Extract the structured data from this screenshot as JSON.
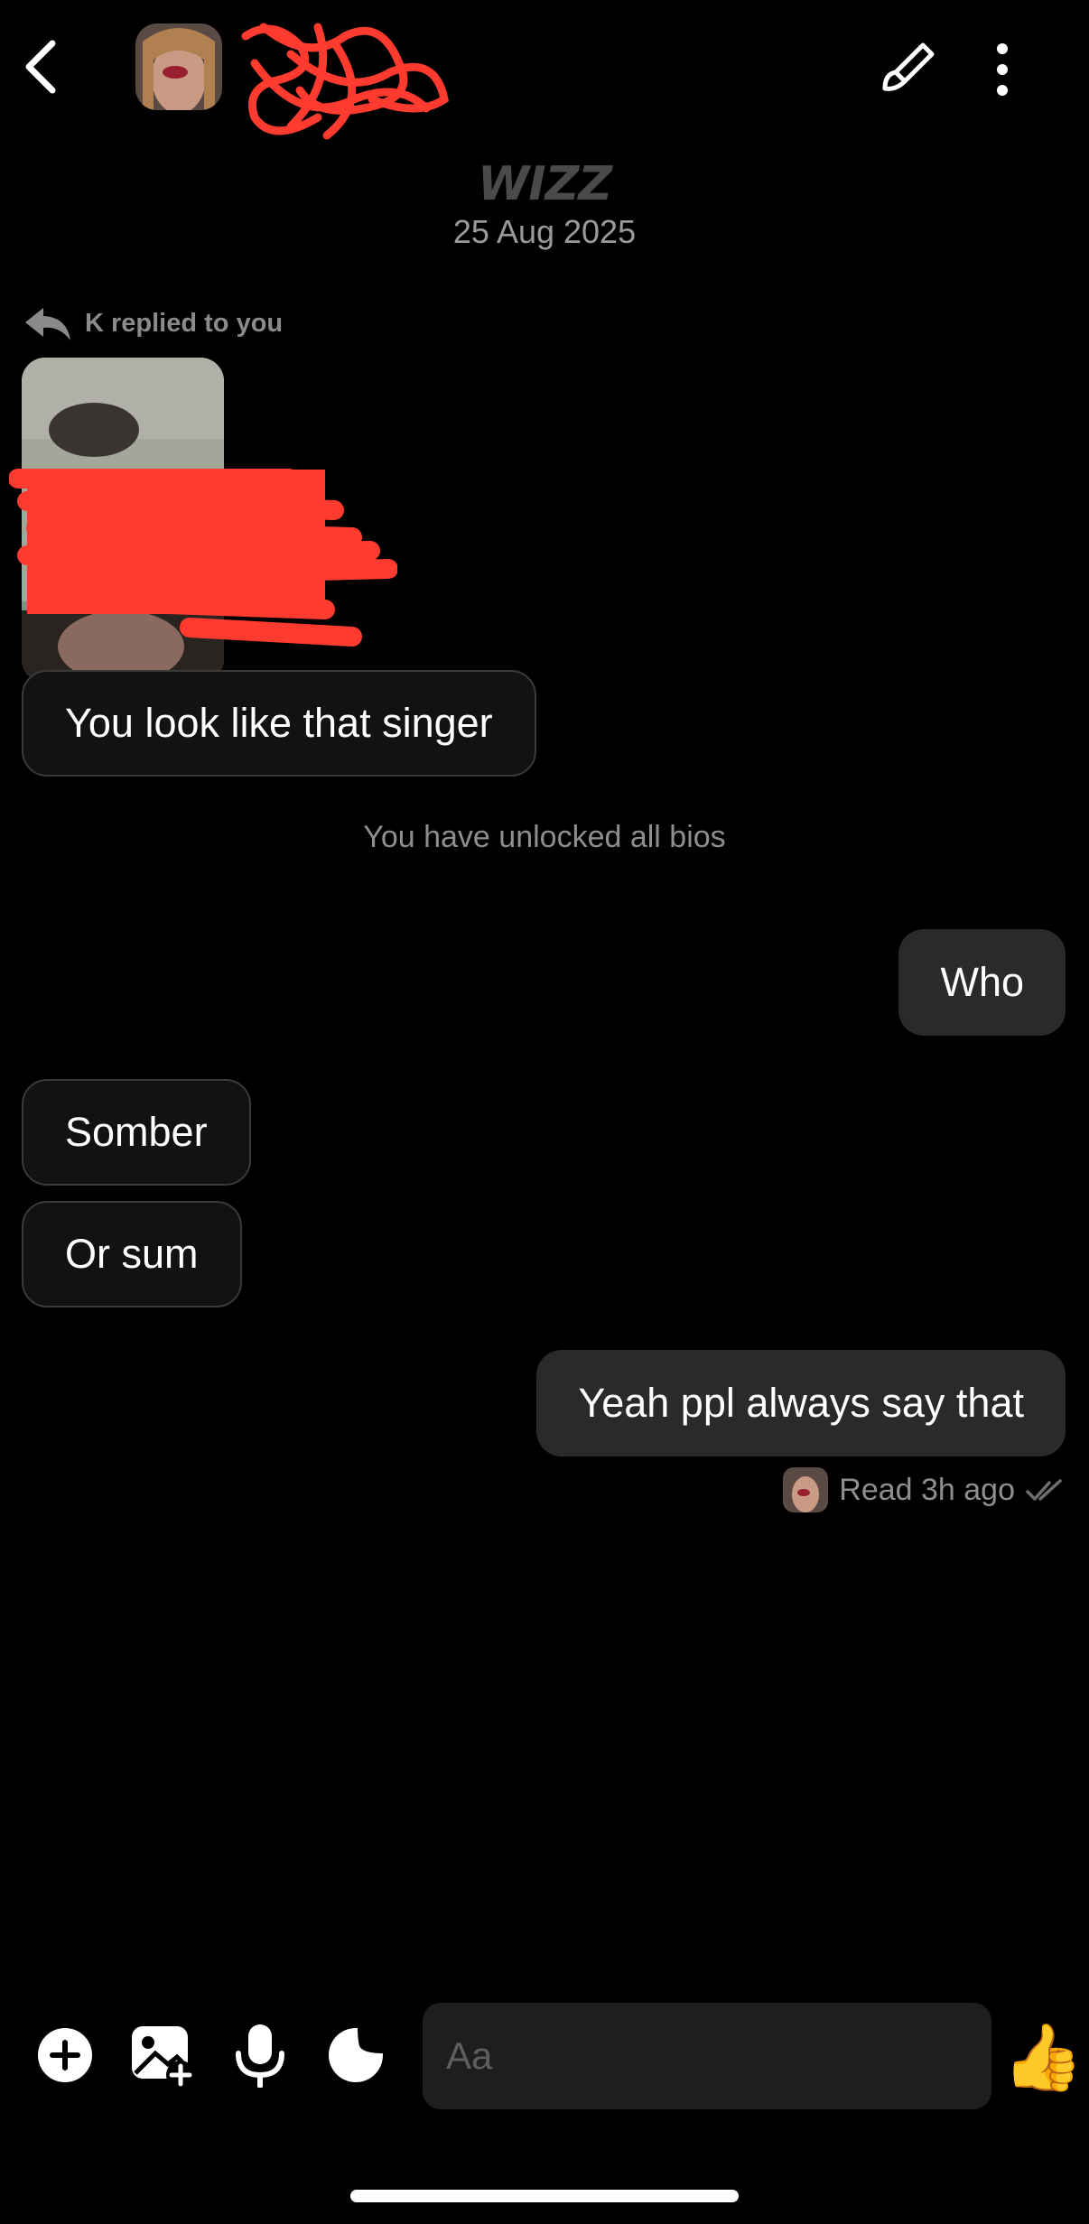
{
  "header": {
    "back_icon": "chevron-left-icon",
    "edit_icon": "brush-icon",
    "more_icon": "vertical-dots-icon"
  },
  "app_logo": "WIZZ",
  "conversation_date": "25 Aug 2025",
  "reply_indicator": {
    "icon": "reply-arrow-icon",
    "text": "K replied to you"
  },
  "messages": [
    {
      "side": "in",
      "text": "You look like that singer"
    },
    {
      "side": "out",
      "text": "Who"
    },
    {
      "side": "in",
      "text": "Somber"
    },
    {
      "side": "in",
      "text": "Or sum"
    },
    {
      "side": "out",
      "text": "Yeah ppl always say that"
    }
  ],
  "system_note": "You have unlocked all bios",
  "read_receipt": {
    "text": "Read 3h ago",
    "icon": "double-check-icon"
  },
  "composer": {
    "placeholder": "Aa",
    "add_icon": "plus-circle-icon",
    "gallery_icon": "image-plus-icon",
    "mic_icon": "microphone-icon",
    "sticker_icon": "sticker-icon",
    "like_emoji": "👍"
  },
  "colors": {
    "background": "#000000",
    "incoming_bubble": "#121212",
    "outgoing_bubble": "#2a2a2c",
    "muted_text": "#8e8e8e",
    "redaction": "#ff3b30"
  }
}
